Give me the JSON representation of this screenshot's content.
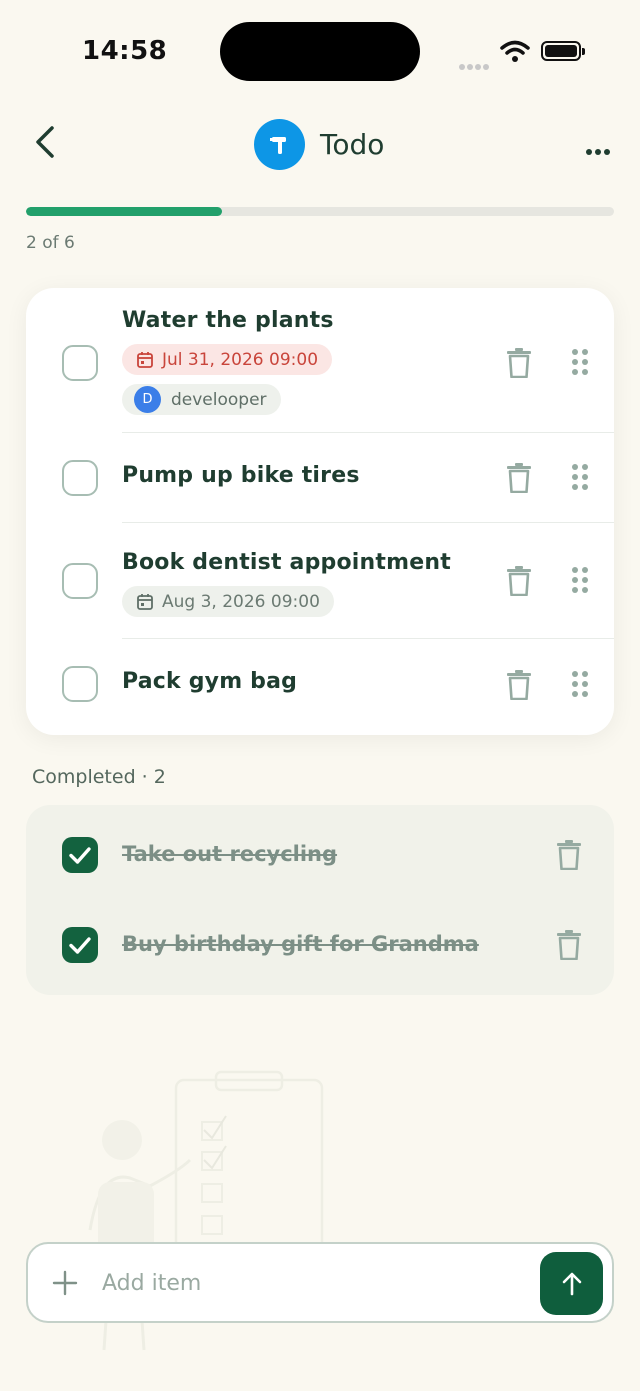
{
  "status_bar": {
    "time": "14:58"
  },
  "header": {
    "title": "Todo"
  },
  "progress": {
    "completed": 2,
    "total": 6,
    "fraction": 0.333,
    "text": "2 of 6"
  },
  "colors": {
    "accent": "#22a06b",
    "app_icon": "#0d96e6",
    "primary_dark": "#0f5e3d",
    "due_overdue": "#c9453b"
  },
  "items": [
    {
      "title": "Water the plants",
      "due": "Jul 31, 2026 09:00",
      "due_state": "overdue",
      "assignee": "develooper",
      "assignee_initial": "D"
    },
    {
      "title": "Pump up bike tires"
    },
    {
      "title": "Book dentist appointment",
      "due": "Aug 3, 2026 09:00",
      "due_state": "upcoming"
    },
    {
      "title": "Pack gym bag"
    }
  ],
  "completed": {
    "label": "Completed · 2",
    "items": [
      {
        "title": "Take out recycling"
      },
      {
        "title": "Buy birthday gift for Grandma"
      }
    ]
  },
  "add_bar": {
    "placeholder": "Add item",
    "value": ""
  },
  "icons": {
    "back": "chevron-left-icon",
    "app": "hammer-icon",
    "more": "more-horizontal-icon",
    "trash": "trash-icon",
    "drag": "drag-handle-icon",
    "calendar": "calendar-icon",
    "plus": "plus-icon",
    "send": "arrow-up-icon"
  }
}
